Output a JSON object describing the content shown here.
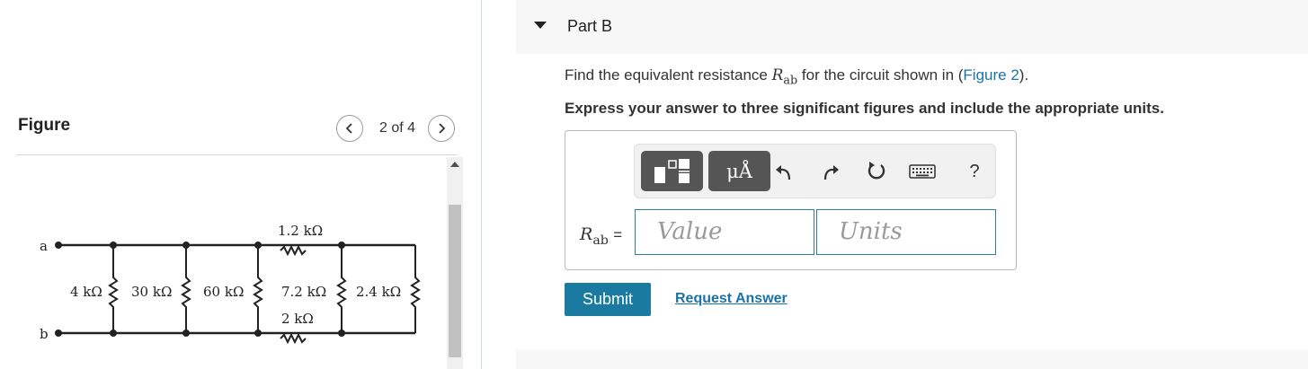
{
  "figure_panel": {
    "title": "Figure",
    "pager": {
      "current": "2 of 4"
    },
    "circuit": {
      "node_a": "a",
      "node_b": "b",
      "resistors": [
        "4 kΩ",
        "30 kΩ",
        "60 kΩ",
        "1.2 kΩ",
        "7.2 kΩ",
        "2 kΩ",
        "2.4 kΩ"
      ]
    }
  },
  "part": {
    "title": "Part B",
    "question_prefix": "Find the equivalent resistance ",
    "question_var": "R",
    "question_sub": "ab",
    "question_mid": " for the circuit shown in (",
    "figure_link": "Figure 2",
    "question_suffix": ").",
    "instruction": "Express your answer to three significant figures and include the appropriate units."
  },
  "answer": {
    "var": "R",
    "sub": "ab",
    "equals": "=",
    "value_placeholder": "Value",
    "units_placeholder": "Units",
    "toolbar": {
      "units_label": "μÅ",
      "help_label": "?"
    }
  },
  "actions": {
    "submit": "Submit",
    "request_answer": "Request Answer"
  },
  "colors": {
    "accent": "#1a7aa0",
    "link": "#1a73a8",
    "input_border": "#2f7f95"
  }
}
